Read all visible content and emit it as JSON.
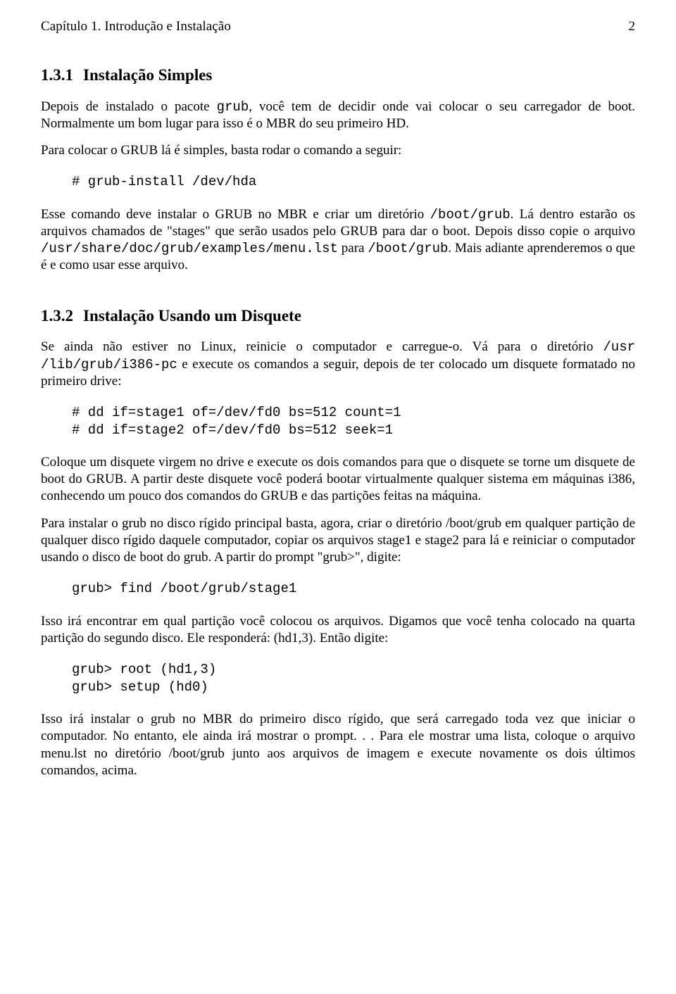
{
  "header": {
    "chapter": "Capítulo 1. Introdução e Instalação",
    "page_number": "2"
  },
  "section1": {
    "number": "1.3.1",
    "title": "Instalação Simples",
    "para1_a": "Depois de instalado o pacote ",
    "para1_code": "grub",
    "para1_b": ", você tem de decidir onde vai colocar o seu carregador de boot. Normalmente um bom lugar para isso é o MBR do seu primeiro HD.",
    "para2": "Para colocar o GRUB lá é simples, basta rodar o comando a seguir:",
    "code1": "# grub-install /dev/hda",
    "para3_a": "Esse comando deve instalar o GRUB no MBR e criar um diretório ",
    "para3_c1": "/boot/grub",
    "para3_b": ". Lá dentro estarão os arquivos chamados de \"stages\" que serão usados pelo GRUB para dar o boot. Depois disso copie o arquivo ",
    "para3_c2": "/usr/share/doc/grub/examples/menu.lst",
    "para3_c": " para ",
    "para3_c3": "/boot/grub",
    "para3_d": ". Mais adiante aprenderemos o que é e como usar esse arquivo."
  },
  "section2": {
    "number": "1.3.2",
    "title": "Instalação Usando um Disquete",
    "para1_a": "Se ainda não estiver no Linux, reinicie o computador e carregue-o. Vá para o diretório ",
    "para1_c1": "/usr /lib/grub/i386-pc",
    "para1_b": " e execute os comandos a seguir, depois de ter colocado um disquete formatado no primeiro drive:",
    "code1": "# dd if=stage1 of=/dev/fd0 bs=512 count=1\n# dd if=stage2 of=/dev/fd0 bs=512 seek=1",
    "para2": "Coloque um disquete virgem no drive e execute os dois comandos para que o disquete se torne um disquete de boot do GRUB. A partir deste disquete você poderá bootar virtualmente qualquer sistema em máquinas i386, conhecendo um pouco dos comandos do GRUB e das partições feitas na máquina.",
    "para3": "Para instalar o grub no disco rígido principal basta, agora, criar o diretório /boot/grub em qualquer partição de qualquer disco rígido daquele computador, copiar os arquivos stage1 e stage2 para lá e reiniciar o computador usando o disco de boot do grub. A partir do prompt \"grub>\", digite:",
    "code2": "grub> find /boot/grub/stage1",
    "para4": "Isso irá encontrar em qual partição você colocou os arquivos. Digamos que você tenha colocado na quarta partição do segundo disco. Ele responderá: (hd1,3). Então digite:",
    "code3": "grub> root (hd1,3)\ngrub> setup (hd0)",
    "para5": "Isso irá instalar o grub no MBR do primeiro disco rígido, que será carregado toda vez que iniciar o computador. No entanto, ele ainda irá mostrar o prompt. . . Para ele mostrar uma lista, coloque o arquivo menu.lst no diretório /boot/grub junto aos arquivos de imagem e execute novamente os dois últimos comandos, acima."
  }
}
